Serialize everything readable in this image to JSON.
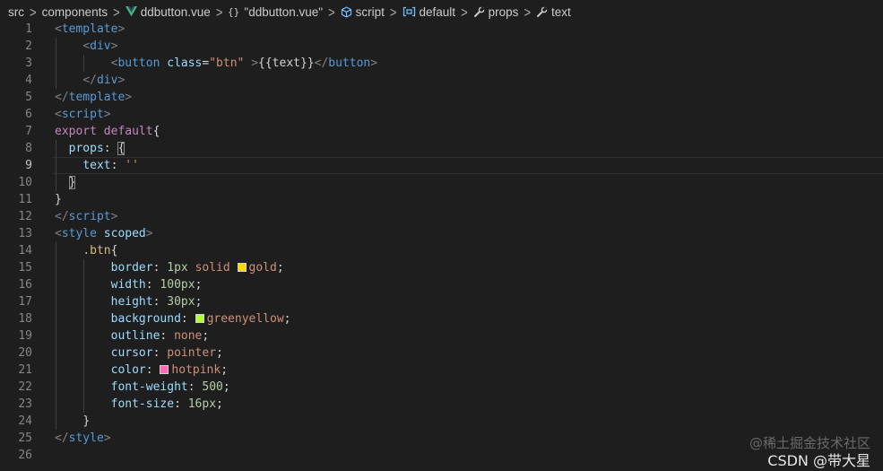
{
  "colors": {
    "background": "#1e1e1e",
    "tag": "#569cd6",
    "tag_bracket": "#808080",
    "attr_name": "#9cdcfe",
    "string": "#ce9178",
    "keyword": "#c586c0",
    "number": "#b5cea8",
    "selector": "#d7ba7d",
    "text": "#d4d4d4",
    "vue_green": "#41b883",
    "ts_blue": "#75beff"
  },
  "breadcrumb": [
    {
      "label": "src",
      "icon": null
    },
    {
      "label": "components",
      "icon": null
    },
    {
      "label": "ddbutton.vue",
      "icon": "vue-logo-icon"
    },
    {
      "label": "\"ddbutton.vue\"",
      "icon": "curly-braces-icon"
    },
    {
      "label": "script",
      "icon": "cube-icon"
    },
    {
      "label": "default",
      "icon": "variable-icon"
    },
    {
      "label": "props",
      "icon": "wrench-icon"
    },
    {
      "label": "text",
      "icon": "wrench-icon"
    }
  ],
  "editor": {
    "current_line": 9,
    "lines": [
      {
        "n": "1",
        "indent": 0,
        "tokens": [
          {
            "t": "<",
            "c": "tag_bracket"
          },
          {
            "t": "template",
            "c": "tag"
          },
          {
            "t": ">",
            "c": "tag_bracket"
          }
        ]
      },
      {
        "n": "2",
        "indent": 1,
        "tokens": [
          {
            "t": "<",
            "c": "tag_bracket"
          },
          {
            "t": "div",
            "c": "tag"
          },
          {
            "t": ">",
            "c": "tag_bracket"
          }
        ]
      },
      {
        "n": "3",
        "indent": 2,
        "tokens": [
          {
            "t": "<",
            "c": "tag_bracket"
          },
          {
            "t": "button",
            "c": "tag"
          },
          {
            "t": " "
          },
          {
            "t": "class",
            "c": "attr_name"
          },
          {
            "t": "="
          },
          {
            "t": "\"btn\"",
            "c": "string"
          },
          {
            "t": " "
          },
          {
            "t": ">",
            "c": "tag_bracket"
          },
          {
            "t": "{{text}}"
          },
          {
            "t": "</",
            "c": "tag_bracket"
          },
          {
            "t": "button",
            "c": "tag"
          },
          {
            "t": ">",
            "c": "tag_bracket"
          }
        ]
      },
      {
        "n": "4",
        "indent": 1,
        "tokens": [
          {
            "t": "</",
            "c": "tag_bracket"
          },
          {
            "t": "div",
            "c": "tag"
          },
          {
            "t": ">",
            "c": "tag_bracket"
          }
        ]
      },
      {
        "n": "5",
        "indent": 0,
        "tokens": [
          {
            "t": "</",
            "c": "tag_bracket"
          },
          {
            "t": "template",
            "c": "tag"
          },
          {
            "t": ">",
            "c": "tag_bracket"
          }
        ]
      },
      {
        "n": "6",
        "indent": 0,
        "tokens": [
          {
            "t": "<",
            "c": "tag_bracket"
          },
          {
            "t": "script",
            "c": "tag"
          },
          {
            "t": ">",
            "c": "tag_bracket"
          }
        ]
      },
      {
        "n": "7",
        "indent": 0,
        "tokens": [
          {
            "t": "export",
            "c": "keyword"
          },
          {
            "t": " "
          },
          {
            "t": "default",
            "c": "keyword"
          },
          {
            "t": "{"
          }
        ]
      },
      {
        "n": "8",
        "indent": 0,
        "tokens": [
          {
            "t": "  "
          },
          {
            "t": "props",
            "c": "attr_name"
          },
          {
            "t": ": "
          },
          {
            "t": "{",
            "bracket": true
          }
        ]
      },
      {
        "n": "9",
        "indent": 0,
        "tokens": [
          {
            "t": "    "
          },
          {
            "t": "text",
            "c": "attr_name"
          },
          {
            "t": ": "
          },
          {
            "t": "''",
            "c": "string"
          }
        ]
      },
      {
        "n": "10",
        "indent": 0,
        "tokens": [
          {
            "t": "  "
          },
          {
            "t": "}",
            "bracket": true
          }
        ]
      },
      {
        "n": "11",
        "indent": 0,
        "tokens": [
          {
            "t": "}"
          }
        ]
      },
      {
        "n": "12",
        "indent": 0,
        "tokens": [
          {
            "t": "</",
            "c": "tag_bracket"
          },
          {
            "t": "script",
            "c": "tag"
          },
          {
            "t": ">",
            "c": "tag_bracket"
          }
        ]
      },
      {
        "n": "13",
        "indent": 0,
        "tokens": [
          {
            "t": "<",
            "c": "tag_bracket"
          },
          {
            "t": "style",
            "c": "tag"
          },
          {
            "t": " "
          },
          {
            "t": "scoped",
            "c": "attr_name"
          },
          {
            "t": ">",
            "c": "tag_bracket"
          }
        ]
      },
      {
        "n": "14",
        "indent": 1,
        "tokens": [
          {
            "t": ".btn",
            "c": "selector"
          },
          {
            "t": "{"
          }
        ]
      },
      {
        "n": "15",
        "indent": 2,
        "tokens": [
          {
            "t": "border",
            "c": "attr_name"
          },
          {
            "t": ": "
          },
          {
            "t": "1px",
            "c": "number"
          },
          {
            "t": " "
          },
          {
            "t": "solid",
            "c": "string"
          },
          {
            "t": " "
          },
          {
            "swatch": "#ffd700"
          },
          {
            "t": "gold",
            "c": "string"
          },
          {
            "t": ";"
          }
        ]
      },
      {
        "n": "16",
        "indent": 2,
        "tokens": [
          {
            "t": "width",
            "c": "attr_name"
          },
          {
            "t": ": "
          },
          {
            "t": "100px",
            "c": "number"
          },
          {
            "t": ";"
          }
        ]
      },
      {
        "n": "17",
        "indent": 2,
        "tokens": [
          {
            "t": "height",
            "c": "attr_name"
          },
          {
            "t": ": "
          },
          {
            "t": "30px",
            "c": "number"
          },
          {
            "t": ";"
          }
        ]
      },
      {
        "n": "18",
        "indent": 2,
        "tokens": [
          {
            "t": "background",
            "c": "attr_name"
          },
          {
            "t": ": "
          },
          {
            "swatch": "#adff2f"
          },
          {
            "t": "greenyellow",
            "c": "string"
          },
          {
            "t": ";"
          }
        ]
      },
      {
        "n": "19",
        "indent": 2,
        "tokens": [
          {
            "t": "outline",
            "c": "attr_name"
          },
          {
            "t": ": "
          },
          {
            "t": "none",
            "c": "string"
          },
          {
            "t": ";"
          }
        ]
      },
      {
        "n": "20",
        "indent": 2,
        "tokens": [
          {
            "t": "cursor",
            "c": "attr_name"
          },
          {
            "t": ": "
          },
          {
            "t": "pointer",
            "c": "string"
          },
          {
            "t": ";"
          }
        ]
      },
      {
        "n": "21",
        "indent": 2,
        "tokens": [
          {
            "t": "color",
            "c": "attr_name"
          },
          {
            "t": ": "
          },
          {
            "swatch": "#ff69b4"
          },
          {
            "t": "hotpink",
            "c": "string"
          },
          {
            "t": ";"
          }
        ]
      },
      {
        "n": "22",
        "indent": 2,
        "tokens": [
          {
            "t": "font-weight",
            "c": "attr_name"
          },
          {
            "t": ": "
          },
          {
            "t": "500",
            "c": "number"
          },
          {
            "t": ";"
          }
        ]
      },
      {
        "n": "23",
        "indent": 2,
        "tokens": [
          {
            "t": "font-size",
            "c": "attr_name"
          },
          {
            "t": ": "
          },
          {
            "t": "16px",
            "c": "number"
          },
          {
            "t": ";"
          }
        ]
      },
      {
        "n": "24",
        "indent": 1,
        "tokens": [
          {
            "t": "}"
          }
        ]
      },
      {
        "n": "25",
        "indent": 0,
        "tokens": [
          {
            "t": "</",
            "c": "tag_bracket"
          },
          {
            "t": "style",
            "c": "tag"
          },
          {
            "t": ">",
            "c": "tag_bracket"
          }
        ]
      },
      {
        "n": "26",
        "indent": 0,
        "tokens": []
      }
    ]
  },
  "watermark": {
    "line1": "@稀土掘金技术社区",
    "line2": "CSDN @带大星"
  }
}
